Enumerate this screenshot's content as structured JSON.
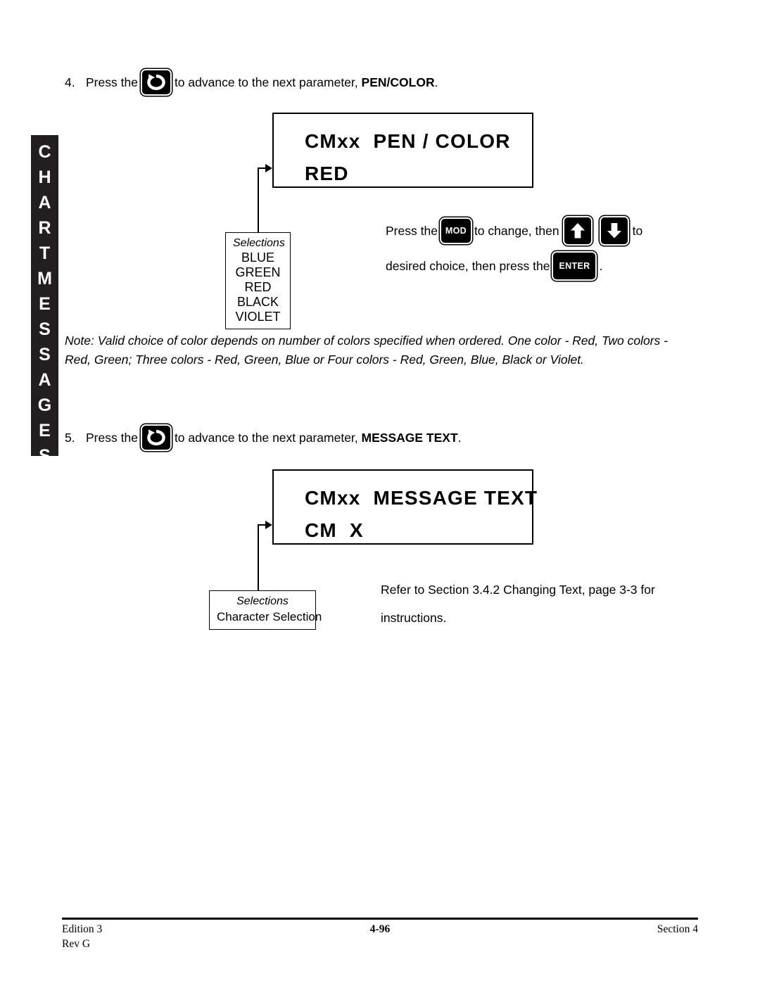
{
  "side_tab": {
    "line1": "CHART",
    "line2": "MESSAGES"
  },
  "steps": [
    {
      "number": "4.",
      "before": "Press the",
      "middle": "to advance to the next parameter,",
      "bold": "PEN/COLOR",
      "after": ".",
      "button": "refresh-icon"
    },
    {
      "number": "5.",
      "before": "Press the",
      "middle": "to advance to the next parameter,",
      "bold": "MESSAGE TEXT",
      "after": ".",
      "button": "refresh-icon"
    }
  ],
  "displays": [
    {
      "line1": "CMxx  PEN / COLOR",
      "line2": "RED"
    },
    {
      "line1": "CMxx  MESSAGE TEXT",
      "line2": "CM  X"
    }
  ],
  "selections": [
    {
      "heading": "Selections",
      "options": [
        "BLUE",
        "GREEN",
        "RED",
        "BLACK",
        "VIOLET"
      ]
    },
    {
      "heading": "Selections",
      "options": [
        "Character Selection"
      ]
    }
  ],
  "instructions": {
    "press_the": "Press the",
    "mod_label": "MOD",
    "to_change_then": "to change, then",
    "to_word": "to",
    "desired_choice": "desired choice, then press the",
    "enter_label": "ENTER",
    "period": "."
  },
  "note": "Note: Valid choice of color depends on number of colors specified when ordered.  One color - Red, Two colors - Red, Green; Three colors - Red, Green, Blue or Four colors - Red, Green, Blue, Black or Violet.",
  "refer": {
    "line1": "Refer to Section 3.4.2 Changing Text, page 3-3 for",
    "line2": "instructions."
  },
  "footer": {
    "edition": "Edition 3",
    "rev": "Rev G",
    "page": "4-96",
    "section": "Section 4"
  },
  "colors": {
    "ink": "#000000",
    "tab_background": "#231f20",
    "paper": "#ffffff"
  }
}
